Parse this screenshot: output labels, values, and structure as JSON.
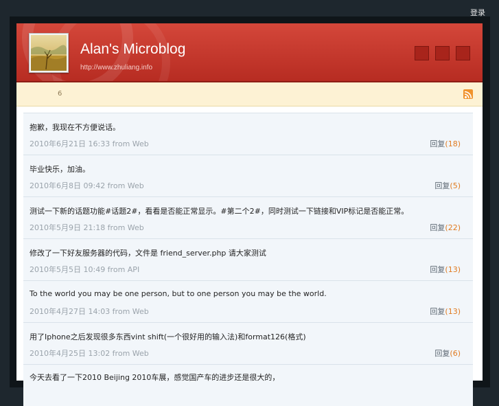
{
  "top_link": "登录",
  "header": {
    "title": "Alan's Microblog",
    "url": "http://www.zhuliang.info"
  },
  "stats": {
    "count": "6"
  },
  "posts": [
    {
      "text": "抱歉，我现在不方便说话。",
      "time": "2010年6月21日 16:33 from Web",
      "reply_label": "回复",
      "reply_count": "(18)"
    },
    {
      "text": "毕业快乐，加油。",
      "time": "2010年6月8日 09:42 from Web",
      "reply_label": "回复",
      "reply_count": "(5)"
    },
    {
      "text": "测试一下新的话题功能#话题2#，看看是否能正常显示。#第二个2#，同时测试一下链接和VIP标记是否能正常。",
      "time": "2010年5月9日 21:18 from Web",
      "reply_label": "回复",
      "reply_count": "(22)"
    },
    {
      "text": "修改了一下好友服务器的代码，文件是 friend_server.php 请大家测试",
      "time": "2010年5月5日 10:49 from API",
      "reply_label": "回复",
      "reply_count": "(13)"
    },
    {
      "text": "To the world you may be one person, but to one person you may be the world.",
      "time": "2010年4月27日 14:03 from Web",
      "reply_label": "回复",
      "reply_count": "(13)"
    },
    {
      "text": "用了Iphone之后发现很多东西vint shift(一个很好用的输入法)和format126(格式)",
      "time": "2010年4月25日 13:02 from Web",
      "reply_label": "回复",
      "reply_count": "(6)"
    }
  ],
  "partial_post_text": "今天去看了一下2010 Beijing 2010车展，感觉国产车的进步还是很大的，"
}
